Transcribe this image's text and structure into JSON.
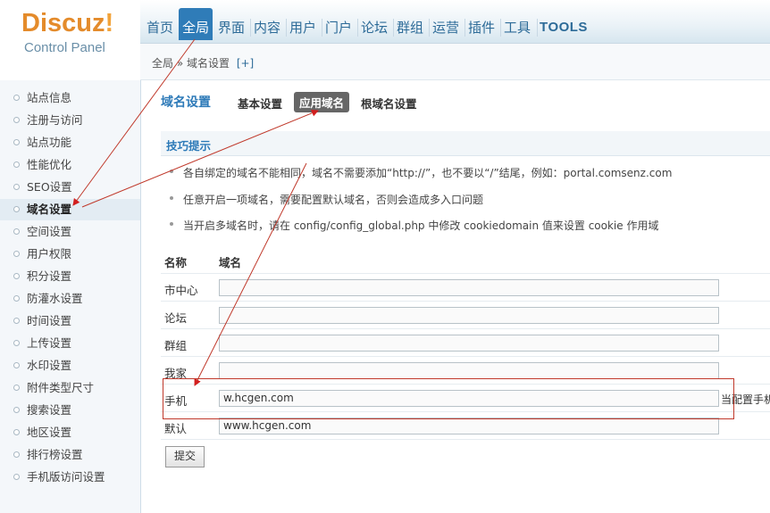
{
  "logo": {
    "title_main": "Discuz",
    "title_bang": "!",
    "subtitle": "Control Panel"
  },
  "topnav": {
    "tabs": [
      "首页",
      "全局",
      "界面",
      "内容",
      "用户",
      "门户",
      "论坛",
      "群组",
      "运营",
      "插件",
      "工具",
      "TOOLS"
    ],
    "active": "全局"
  },
  "breadcrumb": {
    "path": "全局 » 域名设置",
    "add": "[+]"
  },
  "sidebar": {
    "items": [
      "站点信息",
      "注册与访问",
      "站点功能",
      "性能优化",
      "SEO设置",
      "域名设置",
      "空间设置",
      "用户权限",
      "积分设置",
      "防灌水设置",
      "时间设置",
      "上传设置",
      "水印设置",
      "附件类型尺寸",
      "搜索设置",
      "地区设置",
      "排行榜设置",
      "手机版访问设置"
    ],
    "active": "域名设置"
  },
  "subhead": {
    "title": "域名设置",
    "tabs": [
      "基本设置",
      "应用域名",
      "根域名设置"
    ],
    "active_tab": "应用域名"
  },
  "tips": {
    "title": "技巧提示",
    "items": [
      "各自绑定的域名不能相同，域名不需要添加“http://”，也不要以“/”结尾，例如：portal.comsenz.com",
      "任意开启一项域名，需要配置默认域名，否则会造成多入口问题",
      "当开启多域名时，请在 config/config_global.php 中修改 cookiedomain 值来设置 cookie 作用域"
    ]
  },
  "table": {
    "headers": [
      "名称",
      "域名"
    ],
    "rows": [
      {
        "name": "市中心",
        "value": ""
      },
      {
        "name": "论坛",
        "value": ""
      },
      {
        "name": "群组",
        "value": ""
      },
      {
        "name": "我家",
        "value": ""
      },
      {
        "name": "手机",
        "value": "w.hcgen.com",
        "note": "当配置手机"
      },
      {
        "name": "默认",
        "value": "www.hcgen.com"
      }
    ]
  },
  "submit": {
    "label": "提交"
  },
  "colors": {
    "accent": "#2f7cb8",
    "logo": "#e48b2b",
    "annotation": "#c0392b"
  }
}
